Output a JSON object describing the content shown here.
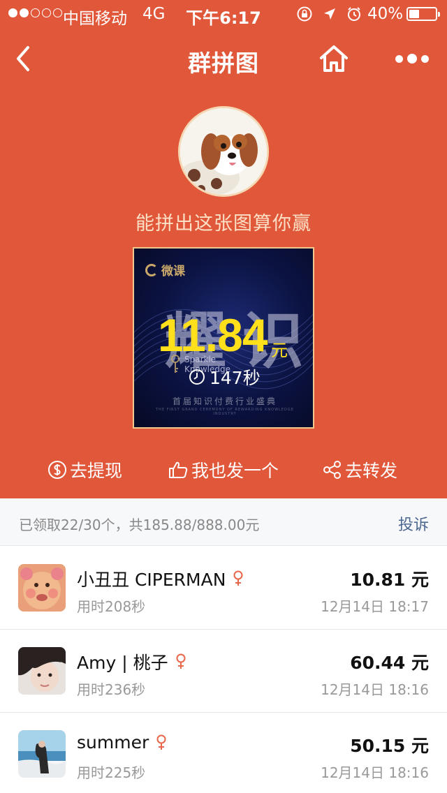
{
  "status_bar": {
    "carrier": "中国移动",
    "network": "4G",
    "time": "下午6:17",
    "battery": "40%",
    "battery_level": 0.4
  },
  "nav": {
    "title": "群拼图"
  },
  "hero": {
    "tagline": "能拼出这张图算你赢",
    "puzzle": {
      "brand": "微课",
      "amount": "11.84",
      "unit": "元",
      "duration": "147秒",
      "sparkle": "Sparkle",
      "knowledge": "Knowledge",
      "banner": "首届知识付费行业盛典",
      "banner_sub": "THE FIRST GRAND CEREMONY OF REWARDING KNOWLEDGE INDUSTRY"
    },
    "actions": {
      "withdraw": "去提现",
      "create": "我也发一个",
      "share": "去转发"
    }
  },
  "summary": {
    "text": "已领取22/30个，共185.88/888.00元",
    "report": "投诉"
  },
  "records": [
    {
      "name": "小丑丑 CIPERMAN",
      "time_used": "用时208秒",
      "amount": "10.81 元",
      "date": "12月14日 18:17"
    },
    {
      "name": "Amy | 桃子",
      "time_used": "用时236秒",
      "amount": "60.44 元",
      "date": "12月14日 18:16"
    },
    {
      "name": "summer",
      "time_used": "用时225秒",
      "amount": "50.15 元",
      "date": "12月14日 18:16"
    }
  ],
  "colors": {
    "hero_bg": "#e0573a",
    "amount_yellow": "#ffe01a",
    "female_icon": "#e8674a",
    "report_link": "#4a6792"
  }
}
